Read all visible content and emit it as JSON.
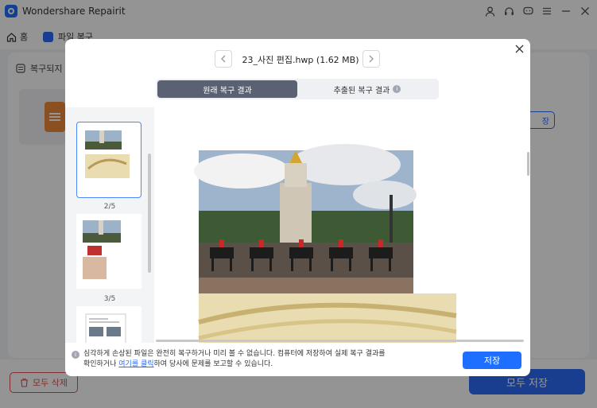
{
  "app": {
    "title": "Wondershare Repairit"
  },
  "nav": {
    "home_label": "홈",
    "file_repair_label": "파일 복구"
  },
  "panel": {
    "header_label": "복구되지",
    "save_label": "장"
  },
  "bottom": {
    "delete_all_label": "모두 삭제",
    "save_all_label": "모두 저장"
  },
  "modal": {
    "file_title": "23_사진 편집.hwp (1.62 MB)",
    "tabs": [
      {
        "label": "원래 복구 결과",
        "active": true
      },
      {
        "label": "추출된 복구 결과",
        "active": false
      }
    ],
    "thumbnails": [
      {
        "page_label": "2/5"
      },
      {
        "page_label": "3/5"
      }
    ],
    "notice_text_1": "심각하게 손상된 파일은 완전히 복구하거나 미리 볼 수 없습니다. 컴퓨터에 저장하여 실제 복구 결과를",
    "notice_text_2a": "확인하거나 ",
    "notice_link": "여기를 클릭",
    "notice_text_2b": "하여 당사에 문제를 보고할 수 있습니다.",
    "save_label": "저장"
  },
  "colors": {
    "accent": "#1e6fff",
    "danger": "#e05050",
    "tab_active": "#5a6172"
  }
}
